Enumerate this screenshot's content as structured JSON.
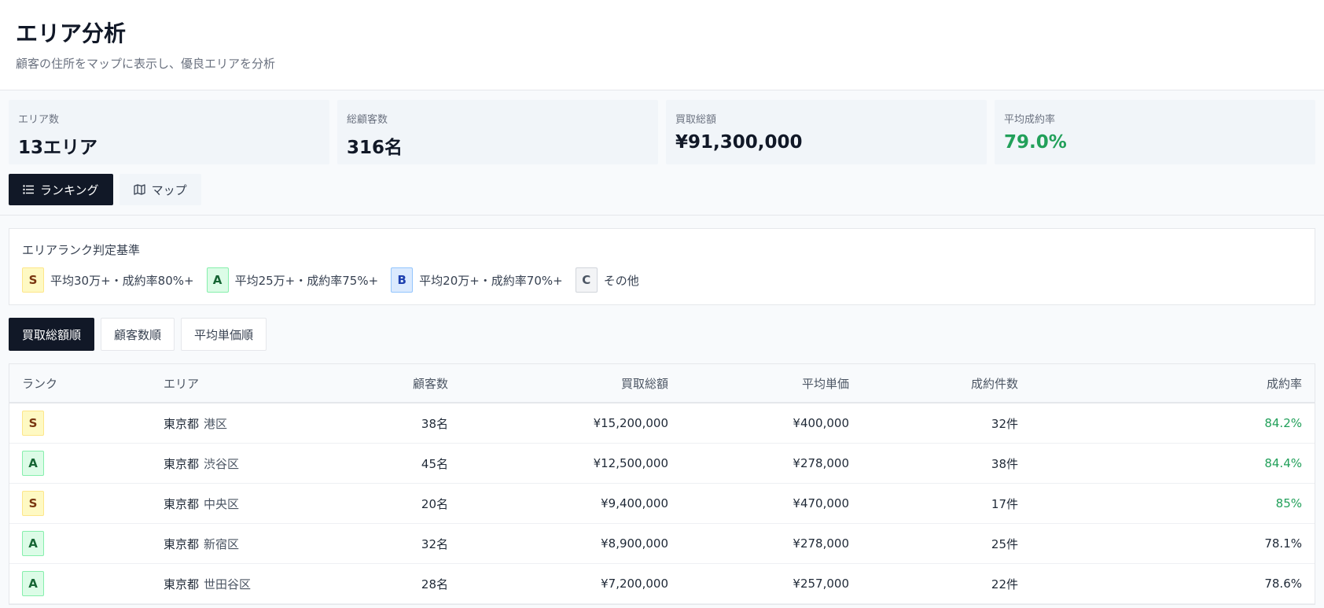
{
  "header": {
    "title": "エリア分析",
    "subtitle": "顧客の住所をマップに表示し、優良エリアを分析"
  },
  "stats": [
    {
      "label": "エリア数",
      "value": "13エリア"
    },
    {
      "label": "総顧客数",
      "value": "316名"
    },
    {
      "label": "買取総額",
      "value": "¥91,300,000"
    },
    {
      "label": "平均成約率",
      "value": "79.0%",
      "color": "#22a05a"
    }
  ],
  "view_tabs": {
    "ranking": {
      "label": "ランキング",
      "icon": "list-icon",
      "active": true
    },
    "map": {
      "label": "マップ",
      "icon": "map-icon",
      "active": false
    }
  },
  "criteria": {
    "title": "エリアランク判定基準",
    "items": [
      {
        "rank": "S",
        "text": "平均30万+・成約率80%+"
      },
      {
        "rank": "A",
        "text": "平均25万+・成約率75%+"
      },
      {
        "rank": "B",
        "text": "平均20万+・成約率70%+"
      },
      {
        "rank": "C",
        "text": "その他"
      }
    ]
  },
  "sort_tabs": [
    {
      "label": "買取総額順",
      "active": true
    },
    {
      "label": "顧客数順",
      "active": false
    },
    {
      "label": "平均単価順",
      "active": false
    }
  ],
  "table": {
    "headers": {
      "rank": "ランク",
      "area": "エリア",
      "customers": "顧客数",
      "total": "買取総額",
      "avg": "平均単価",
      "deals": "成約件数",
      "rate": "成約率"
    },
    "rows": [
      {
        "rank": "S",
        "pref": "東京都",
        "ward": "港区",
        "customers": "38名",
        "total": "¥15,200,000",
        "avg": "¥400,000",
        "deals": "32件",
        "rate": "84.2%",
        "rate_high": true
      },
      {
        "rank": "A",
        "pref": "東京都",
        "ward": "渋谷区",
        "customers": "45名",
        "total": "¥12,500,000",
        "avg": "¥278,000",
        "deals": "38件",
        "rate": "84.4%",
        "rate_high": true
      },
      {
        "rank": "S",
        "pref": "東京都",
        "ward": "中央区",
        "customers": "20名",
        "total": "¥9,400,000",
        "avg": "¥470,000",
        "deals": "17件",
        "rate": "85%",
        "rate_high": true
      },
      {
        "rank": "A",
        "pref": "東京都",
        "ward": "新宿区",
        "customers": "32名",
        "total": "¥8,900,000",
        "avg": "¥278,000",
        "deals": "25件",
        "rate": "78.1%",
        "rate_high": false
      },
      {
        "rank": "A",
        "pref": "東京都",
        "ward": "世田谷区",
        "customers": "28名",
        "total": "¥7,200,000",
        "avg": "¥257,000",
        "deals": "22件",
        "rate": "78.6%",
        "rate_high": false
      }
    ]
  },
  "colors": {
    "accent_dark": "#111827",
    "success_green": "#22a05a"
  }
}
